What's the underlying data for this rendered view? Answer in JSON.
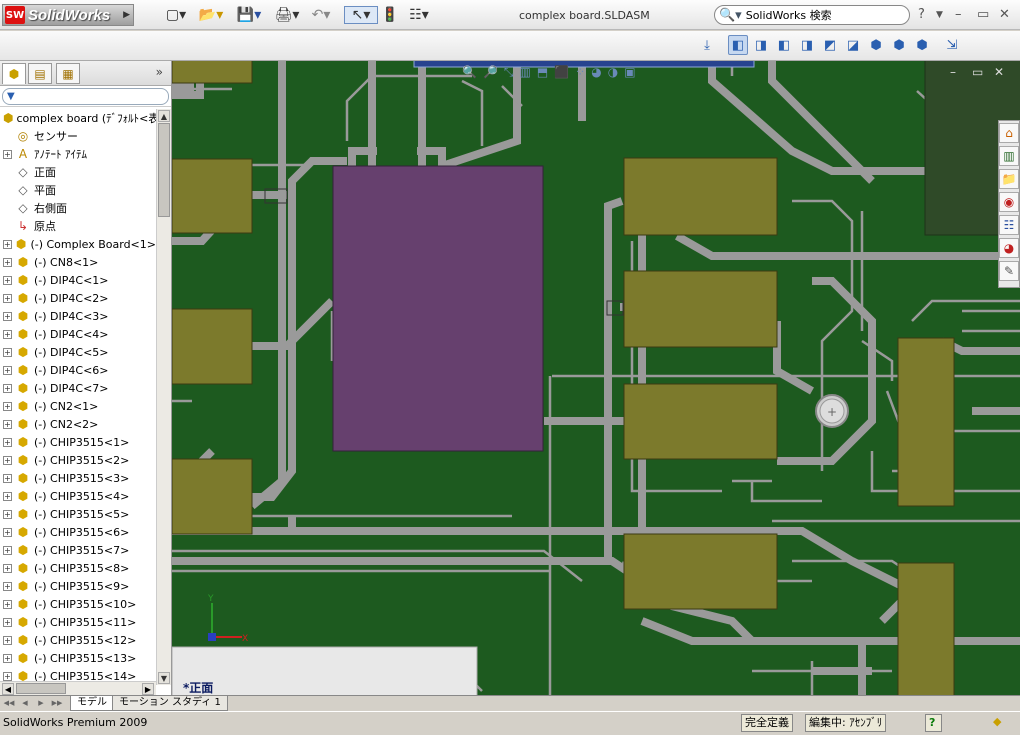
{
  "app": {
    "logo_badge": "SW",
    "logo_text": "SolidWorks",
    "document_title": "complex board.SLDASM"
  },
  "titlebar": {
    "icons": [
      "new-document-icon",
      "open-folder-icon",
      "save-icon",
      "print-icon",
      "undo-icon",
      "select-arrow-icon",
      "rebuild-traffic-light-icon",
      "options-checklist-icon"
    ],
    "search_placeholder": "SolidWorks 検索",
    "help_label": "?",
    "minimize_label": "–",
    "restore_label": "▭",
    "close_label": "✕"
  },
  "feature_manager": {
    "more_label": "»",
    "filter_label": "▼",
    "tree": [
      {
        "label": "complex board  (ﾃﾞﾌｫﾙﾄ<表",
        "icon": "assembly-icon",
        "expand": "none",
        "indent": 0
      },
      {
        "label": "センサー",
        "icon": "sensor-icon",
        "expand": "none",
        "indent": 1
      },
      {
        "label": "ｱﾉﾃｰﾄ ｱｲﾃﾑ",
        "icon": "annotation-icon",
        "expand": "+",
        "indent": 1
      },
      {
        "label": "正面",
        "icon": "plane-icon",
        "expand": "none",
        "indent": 1
      },
      {
        "label": "平面",
        "icon": "plane-icon",
        "expand": "none",
        "indent": 1
      },
      {
        "label": "右側面",
        "icon": "plane-icon",
        "expand": "none",
        "indent": 1
      },
      {
        "label": "原点",
        "icon": "origin-icon",
        "expand": "none",
        "indent": 1
      },
      {
        "label": "(-) Complex Board<1>",
        "icon": "part-icon",
        "expand": "+",
        "indent": 1
      },
      {
        "label": "(-) CN8<1>",
        "icon": "part-icon",
        "expand": "+",
        "indent": 1
      },
      {
        "label": "(-) DIP4C<1>",
        "icon": "part-icon",
        "expand": "+",
        "indent": 1
      },
      {
        "label": "(-) DIP4C<2>",
        "icon": "part-icon",
        "expand": "+",
        "indent": 1
      },
      {
        "label": "(-) DIP4C<3>",
        "icon": "part-icon",
        "expand": "+",
        "indent": 1
      },
      {
        "label": "(-) DIP4C<4>",
        "icon": "part-icon",
        "expand": "+",
        "indent": 1
      },
      {
        "label": "(-) DIP4C<5>",
        "icon": "part-icon",
        "expand": "+",
        "indent": 1
      },
      {
        "label": "(-) DIP4C<6>",
        "icon": "part-icon",
        "expand": "+",
        "indent": 1
      },
      {
        "label": "(-) DIP4C<7>",
        "icon": "part-icon",
        "expand": "+",
        "indent": 1
      },
      {
        "label": "(-) CN2<1>",
        "icon": "part-icon",
        "expand": "+",
        "indent": 1
      },
      {
        "label": "(-) CN2<2>",
        "icon": "part-icon",
        "expand": "+",
        "indent": 1
      },
      {
        "label": "(-) CHIP3515<1>",
        "icon": "part-icon",
        "expand": "+",
        "indent": 1
      },
      {
        "label": "(-) CHIP3515<2>",
        "icon": "part-icon",
        "expand": "+",
        "indent": 1
      },
      {
        "label": "(-) CHIP3515<3>",
        "icon": "part-icon",
        "expand": "+",
        "indent": 1
      },
      {
        "label": "(-) CHIP3515<4>",
        "icon": "part-icon",
        "expand": "+",
        "indent": 1
      },
      {
        "label": "(-) CHIP3515<5>",
        "icon": "part-icon",
        "expand": "+",
        "indent": 1
      },
      {
        "label": "(-) CHIP3515<6>",
        "icon": "part-icon",
        "expand": "+",
        "indent": 1
      },
      {
        "label": "(-) CHIP3515<7>",
        "icon": "part-icon",
        "expand": "+",
        "indent": 1
      },
      {
        "label": "(-) CHIP3515<8>",
        "icon": "part-icon",
        "expand": "+",
        "indent": 1
      },
      {
        "label": "(-) CHIP3515<9>",
        "icon": "part-icon",
        "expand": "+",
        "indent": 1
      },
      {
        "label": "(-) CHIP3515<10>",
        "icon": "part-icon",
        "expand": "+",
        "indent": 1
      },
      {
        "label": "(-) CHIP3515<11>",
        "icon": "part-icon",
        "expand": "+",
        "indent": 1
      },
      {
        "label": "(-) CHIP3515<12>",
        "icon": "part-icon",
        "expand": "+",
        "indent": 1
      },
      {
        "label": "(-) CHIP3515<13>",
        "icon": "part-icon",
        "expand": "+",
        "indent": 1
      },
      {
        "label": "(-) CHIP3515<14>",
        "icon": "part-icon",
        "expand": "+",
        "indent": 1
      }
    ]
  },
  "viewport": {
    "orientation_label": "*正面",
    "board_color": "#1d5a1f",
    "trace_color": "#9a9a9a",
    "ic_color": "#66406e",
    "pad_color": "#7c7a2c",
    "triad_x": "X",
    "triad_y": "Y",
    "doc_minimize": "–",
    "doc_restore": "▭",
    "doc_close": "✕"
  },
  "bottom_tabs": {
    "model": "モデル",
    "motion_study": "モーション スタディ 1"
  },
  "status": {
    "product": "SolidWorks Premium 2009",
    "definition": "完全定義",
    "editing": "編集中: ｱｾﾝﾌﾞﾘ",
    "help": "?"
  }
}
